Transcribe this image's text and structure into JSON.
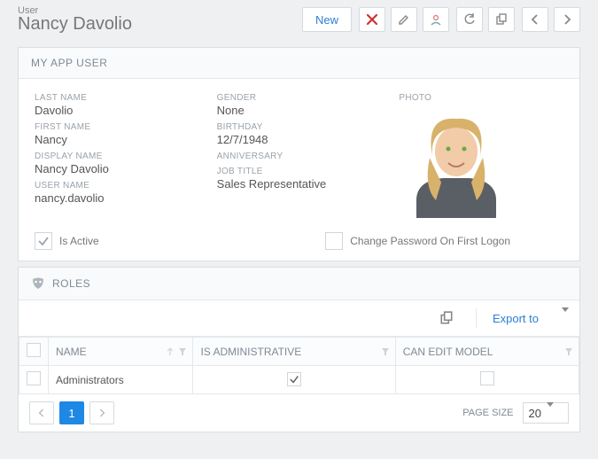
{
  "header": {
    "entity_label": "User",
    "title": "Nancy Davolio",
    "new_label": "New"
  },
  "user_panel": {
    "title": "MY APP USER",
    "labels": {
      "last_name": "LAST NAME",
      "first_name": "FIRST NAME",
      "display_name": "DISPLAY NAME",
      "user_name": "USER NAME",
      "gender": "GENDER",
      "birthday": "BIRTHDAY",
      "anniversary": "ANNIVERSARY",
      "job_title": "JOB TITLE",
      "photo": "PHOTO"
    },
    "values": {
      "last_name": "Davolio",
      "first_name": "Nancy",
      "display_name": "Nancy Davolio",
      "user_name": "nancy.davolio",
      "gender": "None",
      "birthday": "12/7/1948",
      "anniversary": "",
      "job_title": "Sales Representative"
    },
    "is_active_label": "Is Active",
    "is_active_checked": true,
    "change_pwd_label": "Change Password On First Logon",
    "change_pwd_checked": false
  },
  "roles_panel": {
    "title": "ROLES",
    "export_label": "Export to",
    "columns": {
      "name": "NAME",
      "is_admin": "IS ADMINISTRATIVE",
      "can_edit": "CAN EDIT MODEL"
    },
    "rows": [
      {
        "name": "Administrators",
        "is_admin": true,
        "can_edit": false
      }
    ],
    "pager": {
      "current_page": "1",
      "page_size_label": "PAGE SIZE",
      "page_size_value": "20"
    }
  }
}
